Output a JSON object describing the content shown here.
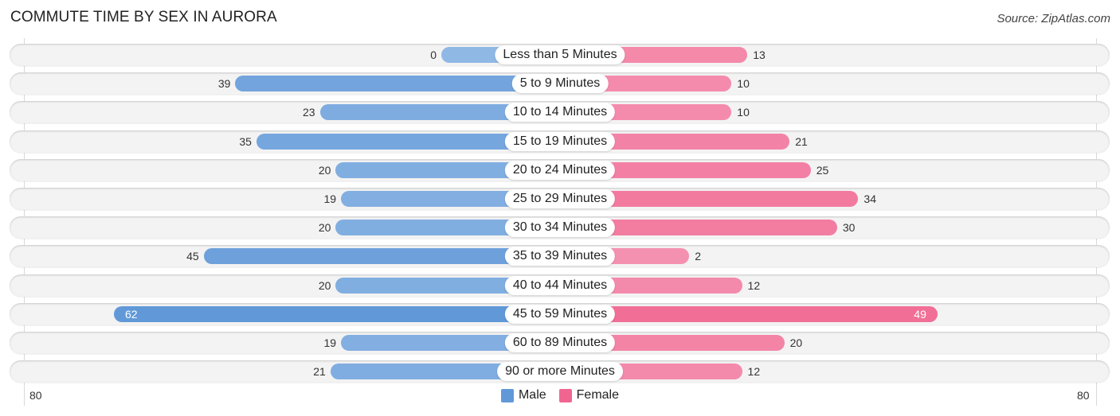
{
  "chart_data": {
    "type": "bar",
    "orientation": "horizontal-diverging",
    "title": "COMMUTE TIME BY SEX IN AURORA",
    "source": "Source: ZipAtlas.com",
    "categories": [
      "Less than 5 Minutes",
      "5 to 9 Minutes",
      "10 to 14 Minutes",
      "15 to 19 Minutes",
      "20 to 24 Minutes",
      "25 to 29 Minutes",
      "30 to 34 Minutes",
      "35 to 39 Minutes",
      "40 to 44 Minutes",
      "45 to 59 Minutes",
      "60 to 89 Minutes",
      "90 or more Minutes"
    ],
    "series": [
      {
        "name": "Male",
        "color": "#6199d8",
        "light_color": "#aac8ec",
        "values": [
          0,
          39,
          23,
          35,
          20,
          19,
          20,
          45,
          20,
          62,
          19,
          21
        ]
      },
      {
        "name": "Female",
        "color": "#f06690",
        "light_color": "#f7aac3",
        "values": [
          13,
          10,
          10,
          21,
          25,
          34,
          30,
          2,
          12,
          49,
          20,
          12
        ]
      }
    ],
    "xlim": [
      80,
      80
    ],
    "axis_labels": {
      "left": "80",
      "right": "80"
    },
    "legend": {
      "placement": "bottom-center",
      "entries": [
        "Male",
        "Female"
      ]
    },
    "grid": false
  }
}
